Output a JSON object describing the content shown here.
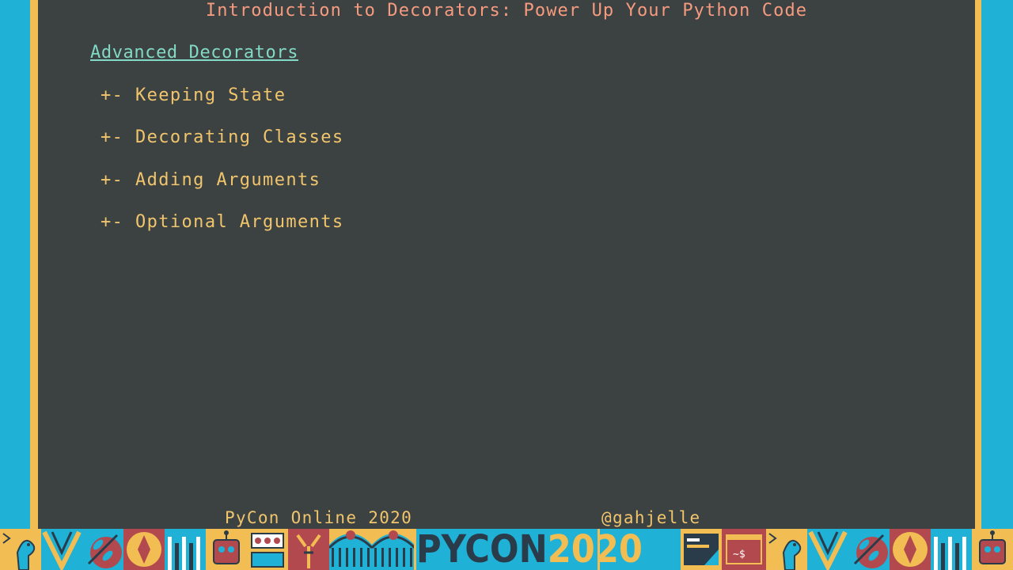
{
  "slide": {
    "title": "Introduction to Decorators: Power Up Your Python Code",
    "section_heading": "Advanced Decorators",
    "items": [
      {
        "prefix": "+-",
        "label": "Keeping State"
      },
      {
        "prefix": "+-",
        "label": "Decorating Classes"
      },
      {
        "prefix": "+-",
        "label": "Adding Arguments"
      },
      {
        "prefix": "+-",
        "label": "Optional Arguments"
      }
    ]
  },
  "footer": {
    "conference": "PyCon Online 2020",
    "handle": "@gahjelle"
  },
  "banner": {
    "logo_py": "PYCON",
    "logo_year": "2020",
    "icons": [
      "terminal-snake-icon",
      "v-shape-icon",
      "leaf-icon",
      "diamond-icon",
      "bars-icon",
      "robot-icon",
      "gears-icon",
      "tool-icon",
      "arch-icon",
      "arch-icon",
      "code-window-icon",
      "shell-prompt-icon",
      "terminal-snake-icon",
      "v-shape-icon",
      "leaf-icon",
      "diamond-icon",
      "bars-icon",
      "robot-icon"
    ],
    "shell_prompt": "~$"
  },
  "colors": {
    "terminal_bg": "#3c4142",
    "title": "#f69b7f",
    "heading": "#82d9c5",
    "text": "#f1c56c",
    "banner_cyan": "#1fb1d6",
    "banner_yellow": "#f2bd52",
    "banner_red": "#b2494f",
    "banner_navy": "#2a3b4a"
  }
}
